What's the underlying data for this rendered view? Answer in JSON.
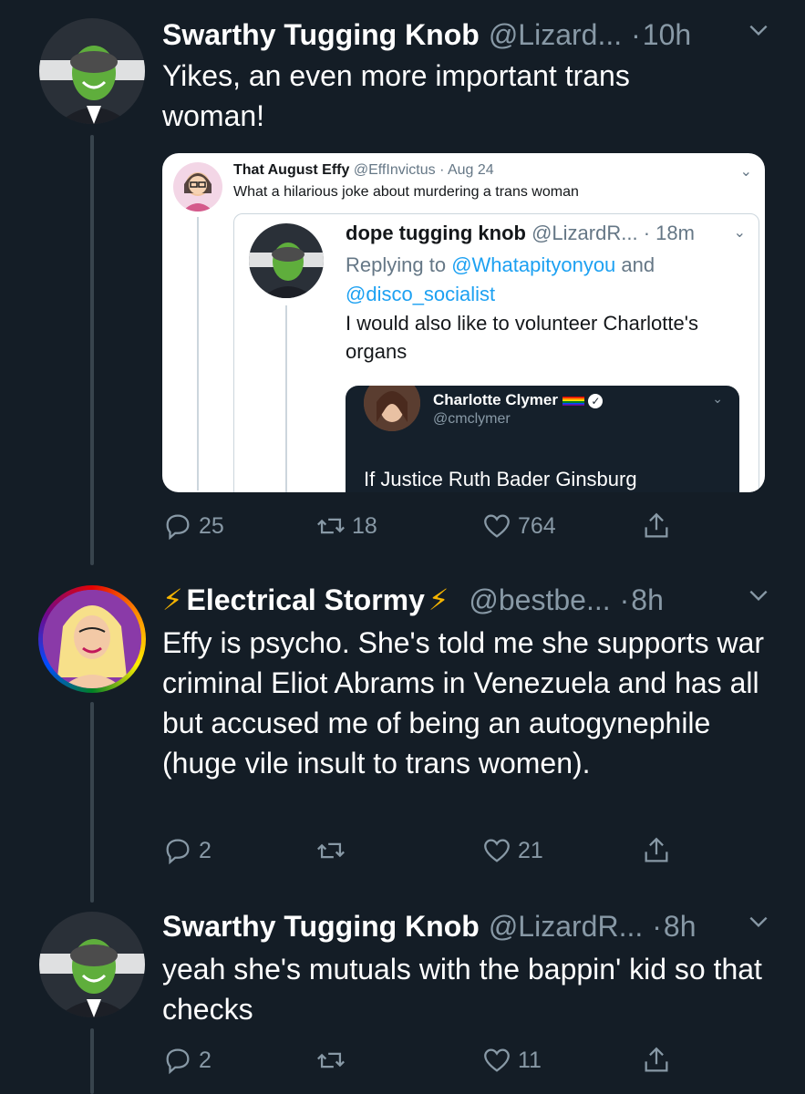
{
  "tweets": [
    {
      "name": "Swarthy Tugging Knob",
      "handle": "@Lizard...",
      "separator": "·",
      "time": "10h",
      "text": "Yikes, an even more important trans woman!",
      "replies": "25",
      "retweets": "18",
      "likes": "764"
    },
    {
      "name": "Electrical Stormy",
      "name_prefix": "⚡",
      "name_suffix": "⚡",
      "handle": "@bestbe...",
      "separator": "·",
      "time": "8h",
      "text": "Effy is psycho. She's told me she supports war criminal Eliot Abrams in Venezuela and has all but accused me of being an autogynephile (huge vile insult to trans women).",
      "replies": "2",
      "retweets": "",
      "likes": "21"
    },
    {
      "name": "Swarthy Tugging Knob",
      "handle": "@LizardR...",
      "separator": "·",
      "time": "8h",
      "text": "yeah she's mutuals with the bappin' kid so that checks",
      "replies": "2",
      "retweets": "",
      "likes": "11"
    }
  ],
  "embed": {
    "name": "That August Effy",
    "handle": "@EffInvictus · Aug 24",
    "text": "What a hilarious joke about murdering a trans woman",
    "inner": {
      "name": "dope tugging knob",
      "handle": "@LizardR...",
      "time": "· 18m",
      "reply_prefix": "Replying to",
      "reply_user1": "@Whatapityonyou",
      "reply_and": "and",
      "reply_user2": "@disco_socialist",
      "text": "I would also like to volunteer Charlotte's organs",
      "quote": {
        "name": "Charlotte Clymer",
        "handle": "@cmclymer",
        "text": "If Justice Ruth Bader Ginsburg"
      }
    }
  },
  "colors": {
    "background": "#141d26",
    "secondary_text": "#8899a6",
    "link": "#1da1f2",
    "stormy_bolt": "#f5b400"
  },
  "icons": [
    "reply-icon",
    "retweet-icon",
    "like-icon",
    "share-icon",
    "chevron-down-icon",
    "verified-icon"
  ]
}
